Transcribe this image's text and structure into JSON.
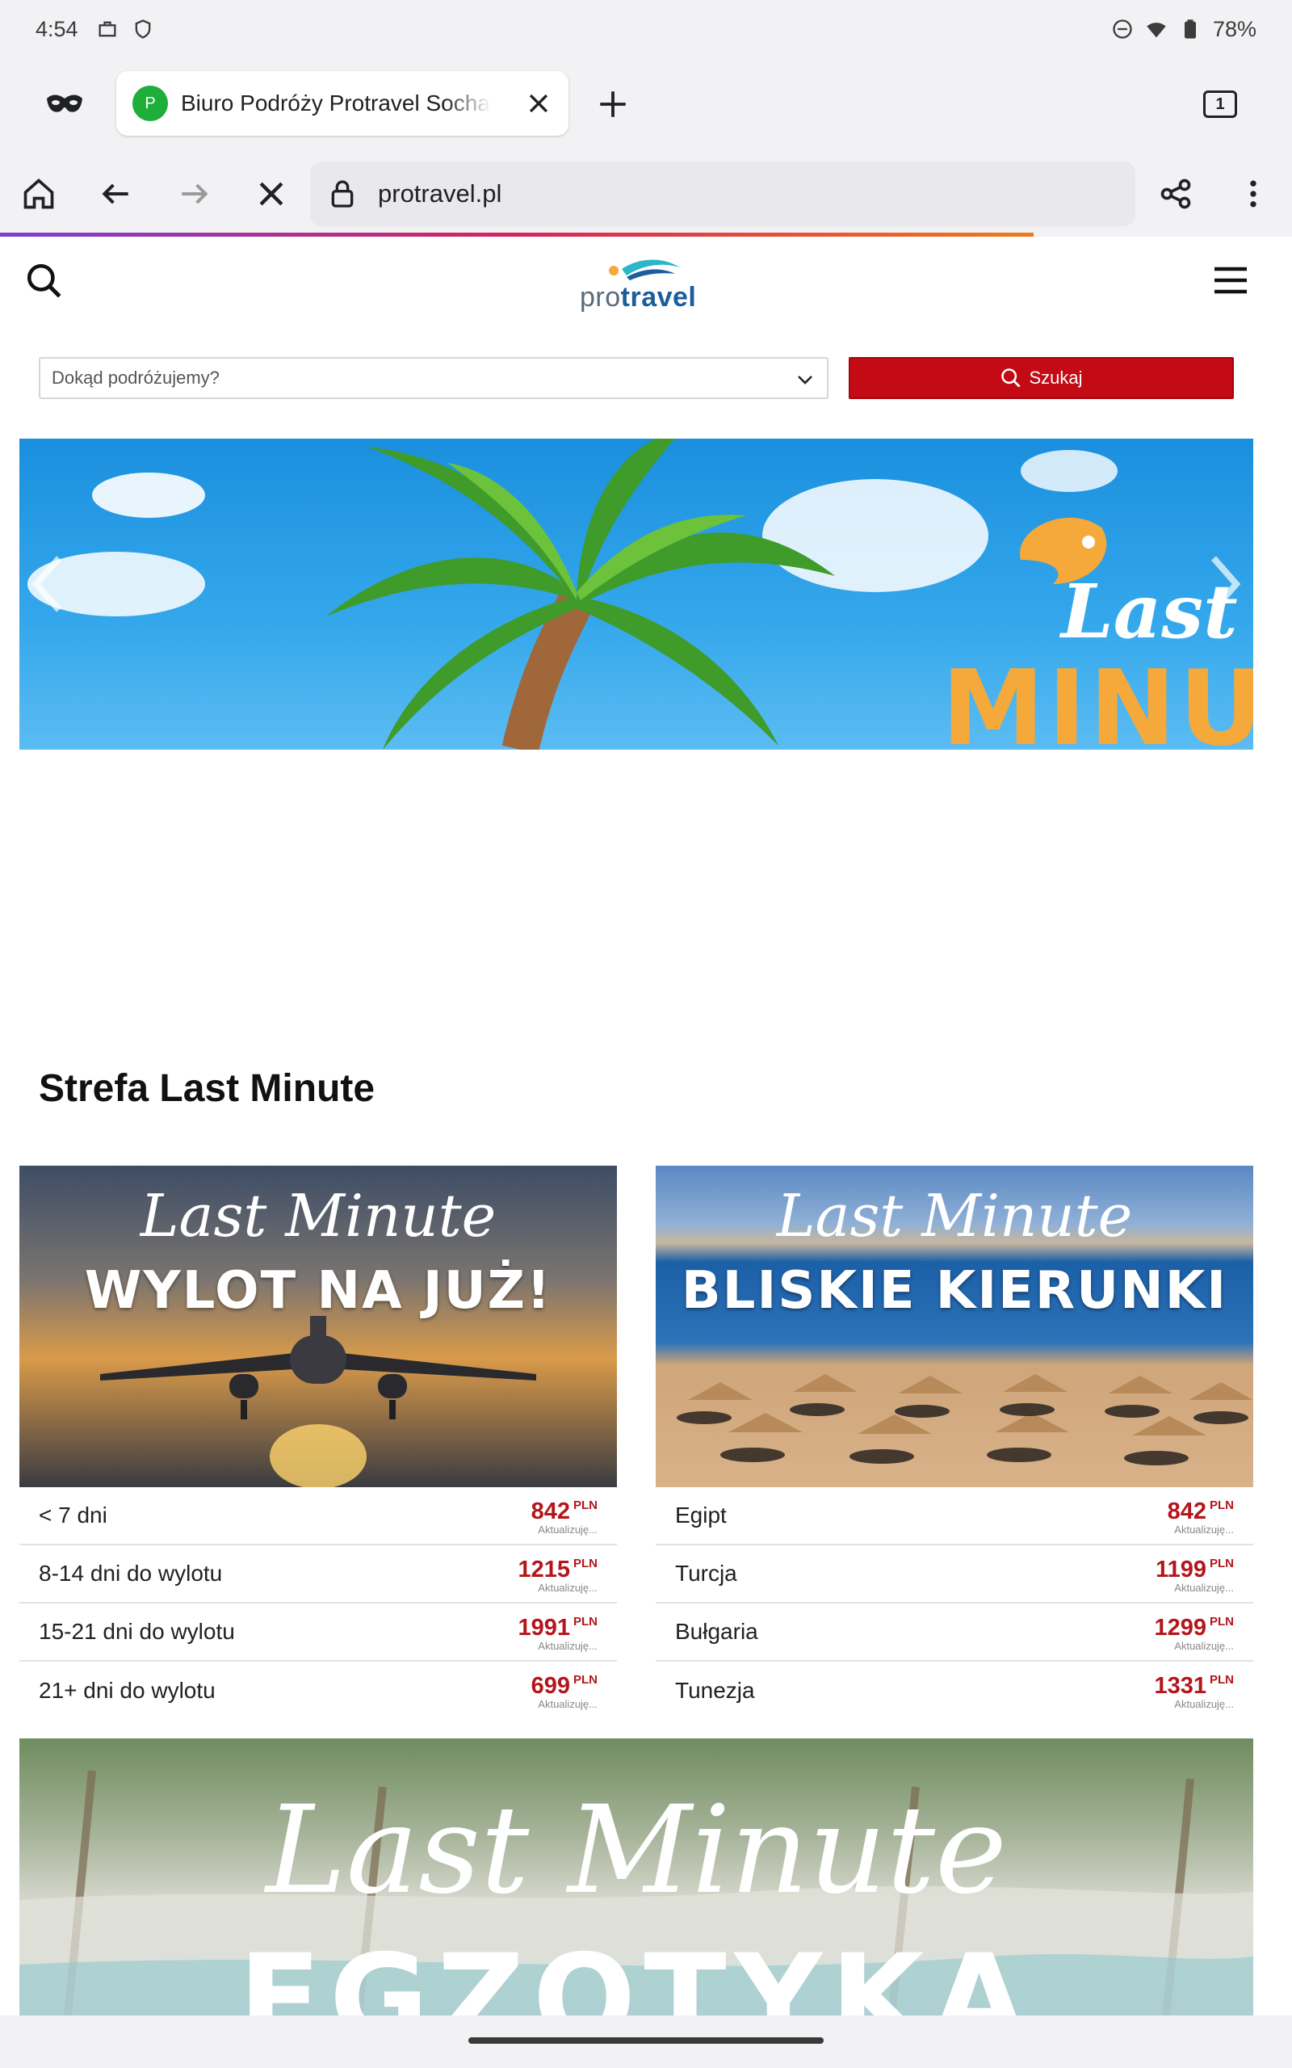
{
  "status_bar": {
    "time": "4:54",
    "battery": "78%",
    "icons_left": [
      "briefcase-icon",
      "shield-icon"
    ],
    "icons_right": [
      "do-not-disturb-icon",
      "wifi-icon",
      "battery-icon"
    ]
  },
  "browser": {
    "tab": {
      "favicon_letter": "P",
      "title": "Biuro Podróży Protravel Sochaczew"
    },
    "tab_count": "1",
    "url": "protravel.pl",
    "progress": 0.8,
    "colors": {
      "favicon": "#1fae3a",
      "chrome_bg": "#f2f2f4"
    }
  },
  "site": {
    "logo": {
      "pro": "pro",
      "travel": "travel"
    },
    "search": {
      "destination_placeholder": "Dokąd podróżujemy?",
      "button_label": "Szukaj"
    },
    "hero": {
      "last": "Last",
      "minute": "MINUT"
    },
    "section_title": "Strefa Last Minute",
    "cards": [
      {
        "script": "Last Minute",
        "heading": "WYLOT NA JUŻ!",
        "rows": [
          {
            "label": "< 7 dni",
            "price": "842",
            "currency": "PLN",
            "note": "Aktualizuję..."
          },
          {
            "label": "8-14 dni do wylotu",
            "price": "1215",
            "currency": "PLN",
            "note": "Aktualizuję..."
          },
          {
            "label": "15-21 dni do wylotu",
            "price": "1991",
            "currency": "PLN",
            "note": "Aktualizuję..."
          },
          {
            "label": "21+ dni do wylotu",
            "price": "699",
            "currency": "PLN",
            "note": "Aktualizuję..."
          }
        ]
      },
      {
        "script": "Last Minute",
        "heading": "BLISKIE KIERUNKI",
        "rows": [
          {
            "label": "Egipt",
            "price": "842",
            "currency": "PLN",
            "note": "Aktualizuję..."
          },
          {
            "label": "Turcja",
            "price": "1199",
            "currency": "PLN",
            "note": "Aktualizuję..."
          },
          {
            "label": "Bułgaria",
            "price": "1299",
            "currency": "PLN",
            "note": "Aktualizuję..."
          },
          {
            "label": "Tunezja",
            "price": "1331",
            "currency": "PLN",
            "note": "Aktualizuję..."
          }
        ]
      }
    ],
    "banner": {
      "script": "Last Minute",
      "heading": "EGZOTYKA"
    },
    "colors": {
      "accent_red": "#c40a14",
      "price_red": "#b4161b",
      "logo_blue": "#1c5e9b"
    }
  }
}
